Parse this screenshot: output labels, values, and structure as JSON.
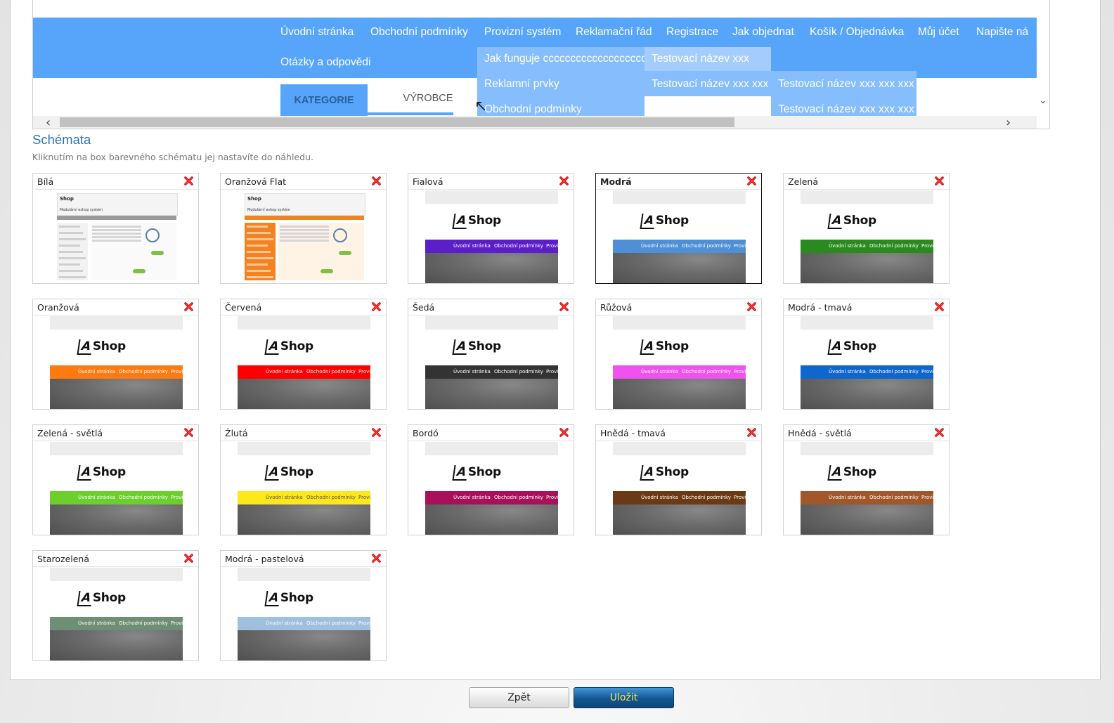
{
  "preview": {
    "nav_row1": [
      "Úvodní stránka",
      "Obchodní podmínky",
      "Provizní systém",
      "Reklamační řád",
      "Registrace",
      "Jak objednat",
      "Košík / Objednávka",
      "Můj účet",
      "Napište ná"
    ],
    "nav_row2": [
      "Otázky a odpovědi"
    ],
    "dropdown_level1": [
      "Jak funguje cccccccccccccccccccx",
      "Reklamní prvky",
      "Obchodní podmínky"
    ],
    "dropdown_level2": [
      "Testovací název xxx",
      "Testovací název xxx xxx"
    ],
    "dropdown_level3": [
      "Testovací název xxx xxx xxx",
      "Testovací název xxx xxx xxx"
    ],
    "tabs": [
      "KATEGORIE",
      "VÝROBCE"
    ],
    "nav_color": "#56a5fb",
    "dropdown_color": "#86bdfc"
  },
  "schemes": {
    "title": "Schémata",
    "description": "Kliknutím na box barevného schématu jej nastavíte do náhledu.",
    "thumb_logo": "Shop",
    "thumb_nav": [
      "Úvodní stránka",
      "Obchodní podmínky",
      "Provi"
    ],
    "site_thumb_logo": "Shop",
    "site_thumb_tagline": "Modulární eshop systém",
    "items": [
      {
        "name": "Bílá",
        "style": "site",
        "color": "#ffffff",
        "selected": false
      },
      {
        "name": "Oranžová Flat",
        "style": "site-orange",
        "color": "#f58220",
        "selected": false
      },
      {
        "name": "Fialová",
        "style": "logo",
        "color": "#5b1fc8",
        "selected": false
      },
      {
        "name": "Modrá",
        "style": "logo",
        "color": "#4f8fd6",
        "selected": true
      },
      {
        "name": "Zelená",
        "style": "logo",
        "color": "#2a8a1f",
        "selected": false
      },
      {
        "name": "Oranžová",
        "style": "logo",
        "color": "#ff7a10",
        "selected": false
      },
      {
        "name": "Červená",
        "style": "logo",
        "color": "#ff0000",
        "selected": false
      },
      {
        "name": "Šedá",
        "style": "logo",
        "color": "#333333",
        "selected": false
      },
      {
        "name": "Růžová",
        "style": "logo",
        "color": "#f052f0",
        "selected": false
      },
      {
        "name": "Modrá - tmavá",
        "style": "logo",
        "color": "#0f66cc",
        "selected": false
      },
      {
        "name": "Zelená - světlá",
        "style": "logo",
        "color": "#6ccf2c",
        "selected": false
      },
      {
        "name": "Žlutá",
        "style": "logo",
        "color": "#ffe81a",
        "selected": false
      },
      {
        "name": "Bordó",
        "style": "logo",
        "color": "#a8105a",
        "selected": false
      },
      {
        "name": "Hnědá - tmavá",
        "style": "logo",
        "color": "#6b3a14",
        "selected": false
      },
      {
        "name": "Hnědá - světlá",
        "style": "logo",
        "color": "#a0572a",
        "selected": false
      },
      {
        "name": "Starozelená",
        "style": "logo",
        "color": "#6f8f74",
        "selected": false
      },
      {
        "name": "Modrá - pastelová",
        "style": "logo",
        "color": "#9fbfdf",
        "selected": false
      }
    ]
  },
  "buttons": {
    "back_label": "Zpět",
    "save_label": "Uložit"
  },
  "icons": {
    "delete": "delete-x-icon",
    "scroll_left": "chevron-left-icon",
    "scroll_right": "chevron-right-icon",
    "scroll_down": "chevron-down-icon"
  }
}
